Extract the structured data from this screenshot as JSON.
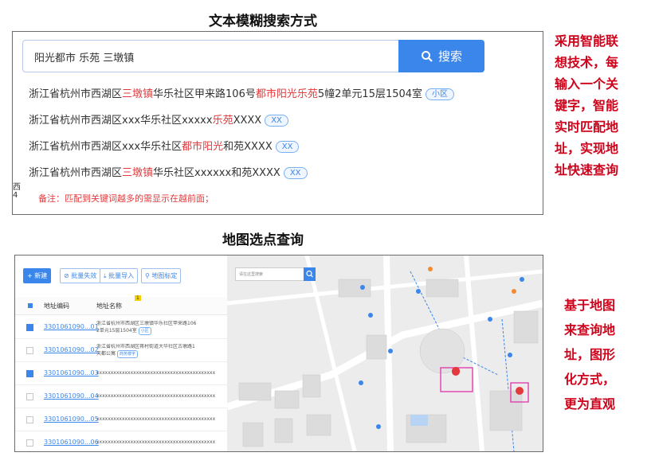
{
  "section1": {
    "title": "文本模糊搜索方式",
    "search": {
      "query": "阳光都市  乐苑  三墩镇",
      "button_label": "搜索"
    },
    "results": [
      [
        {
          "t": "浙江省杭州市西湖区",
          "hl": false
        },
        {
          "t": "三墩镇",
          "hl": true
        },
        {
          "t": "华乐社区甲来路106号",
          "hl": false
        },
        {
          "t": "都市阳光乐苑",
          "hl": true
        },
        {
          "t": "5幢2单元15层1504室",
          "hl": false
        }
      ],
      [
        {
          "t": "浙江省杭州市西湖区xxx华乐社区xxxxx",
          "hl": false
        },
        {
          "t": "乐苑",
          "hl": true
        },
        {
          "t": "XXXX",
          "hl": false
        }
      ],
      [
        {
          "t": "浙江省杭州市西湖区xxx华乐社区",
          "hl": false
        },
        {
          "t": "都市阳光",
          "hl": true
        },
        {
          "t": "和苑XXXX",
          "hl": false
        }
      ],
      [
        {
          "t": "浙江省杭州市西湖区",
          "hl": false
        },
        {
          "t": "三墩镇",
          "hl": true
        },
        {
          "t": "华乐社区xxxxxx和苑XXXX",
          "hl": false
        }
      ]
    ],
    "tags": [
      "小区",
      "XX",
      "XX",
      "XX"
    ],
    "left_cut": [
      "西",
      "4"
    ],
    "note": "备注：匹配到关键词越多的需显示在越前面；",
    "side_text": [
      "采用智能联",
      "想技术，每",
      "输入一个关",
      "键字，智能",
      "实时匹配地",
      "址，实现地",
      "址快速查询"
    ]
  },
  "section2": {
    "title": "地图选点查询",
    "toolbar": {
      "new": "+ 新建",
      "batch_invalid": "批量失效",
      "batch_import": "批量导入",
      "map_locate": "地图标定"
    },
    "table": {
      "col_code": "地址编码",
      "col_name": "地址名称",
      "badge": "1",
      "rows": [
        {
          "code": "3301061090...01",
          "name1": "浙江省杭州市西湖区三墩镇华乐社区甲来路106",
          "name2": "2单元15层1504室",
          "tag": "小区",
          "checked": true
        },
        {
          "code": "3301061090...02",
          "name1": "浙江省杭州市西湖区蒋村街道大华社区古墩路1",
          "name2": "天都公寓",
          "tag": "商务楼宇",
          "checked": false
        },
        {
          "code": "3301061090...03",
          "name1": "xxxxxxxxxxxxxxxxxxxxxxxxxxxxxxxxxxxxxxxxxx",
          "name2": "",
          "tag": "",
          "checked": true
        },
        {
          "code": "3301061090...04",
          "name1": "xxxxxxxxxxxxxxxxxxxxxxxxxxxxxxxxxxxxxxxxxx",
          "name2": "",
          "tag": "",
          "checked": false
        },
        {
          "code": "3301061090...05",
          "name1": "xxxxxxxxxxxxxxxxxxxxxxxxxxxxxxxxxxxxxxxxxx",
          "name2": "",
          "tag": "",
          "checked": false
        },
        {
          "code": "3301061090...06",
          "name1": "xxxxxxxxxxxxxxxxxxxxxxxxxxxxxxxxxxxxxxxxxx",
          "name2": "",
          "tag": "",
          "checked": false
        }
      ]
    },
    "map": {
      "search_placeholder": "请在这里搜索"
    },
    "side_text": [
      "基于地图",
      "来查询地",
      "址，图形",
      "化方式，",
      "更为直观"
    ]
  },
  "colors": {
    "accent": "#3b86ea",
    "highlight": "#e4393c",
    "side_text": "#d0021b",
    "marker_box": "#e040b0"
  }
}
